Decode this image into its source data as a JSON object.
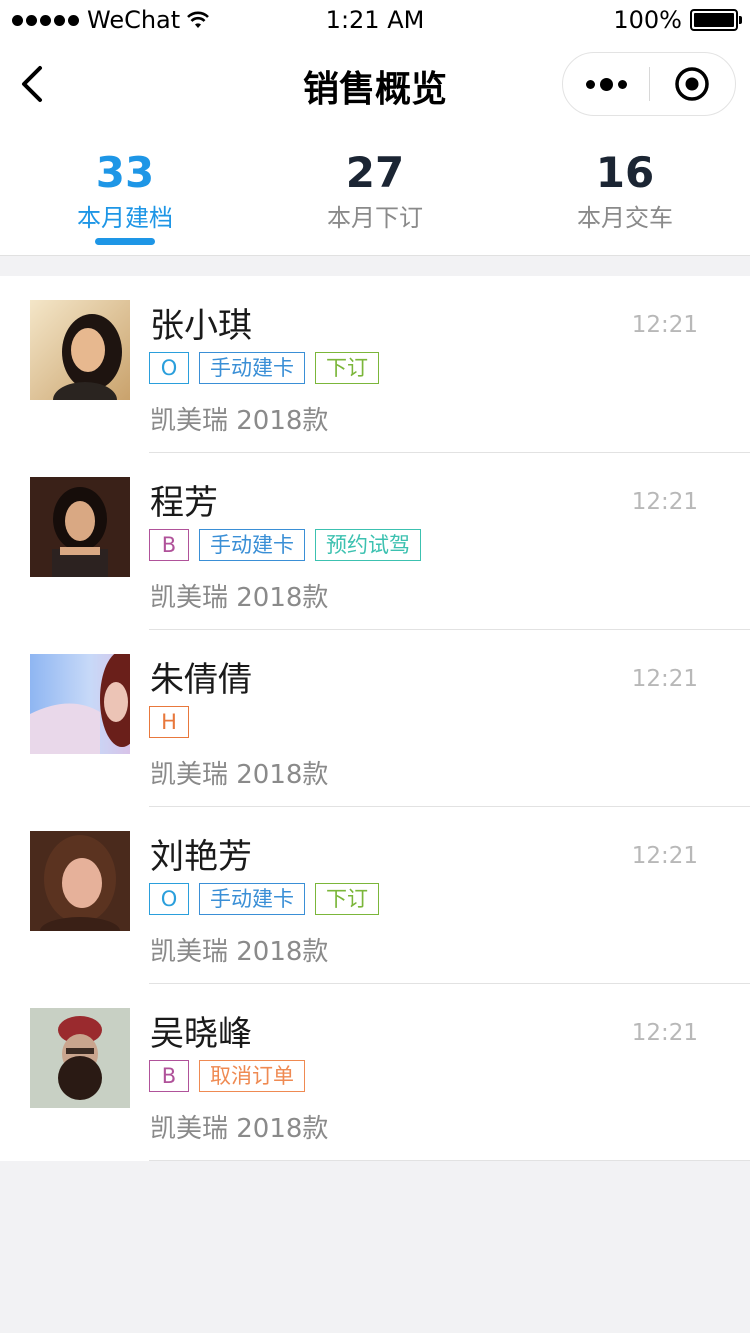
{
  "status_bar": {
    "carrier": "WeChat",
    "time": "1:21 AM",
    "battery": "100%"
  },
  "nav": {
    "title": "销售概览"
  },
  "stats": [
    {
      "num": "33",
      "label": "本月建档",
      "active": true
    },
    {
      "num": "27",
      "label": "本月下订",
      "active": false
    },
    {
      "num": "16",
      "label": "本月交车",
      "active": false
    }
  ],
  "customers": [
    {
      "name": "张小琪",
      "time": "12:21",
      "car": "凯美瑞 2018款",
      "tags": [
        {
          "text": "O",
          "color": "#2a9fdc"
        },
        {
          "text": "手动建卡",
          "color": "#3a8fd6"
        },
        {
          "text": "下订",
          "color": "#7bb63a"
        }
      ]
    },
    {
      "name": "程芳",
      "time": "12:21",
      "car": "凯美瑞 2018款",
      "tags": [
        {
          "text": "B",
          "color": "#b0529a"
        },
        {
          "text": "手动建卡",
          "color": "#3a8fd6"
        },
        {
          "text": "预约试驾",
          "color": "#3cc1b0"
        }
      ]
    },
    {
      "name": "朱倩倩",
      "time": "12:21",
      "car": "凯美瑞 2018款",
      "tags": [
        {
          "text": "H",
          "color": "#e8783c"
        }
      ]
    },
    {
      "name": "刘艳芳",
      "time": "12:21",
      "car": "凯美瑞 2018款",
      "tags": [
        {
          "text": "O",
          "color": "#2a9fdc"
        },
        {
          "text": "手动建卡",
          "color": "#3a8fd6"
        },
        {
          "text": "下订",
          "color": "#7bb63a"
        }
      ]
    },
    {
      "name": "吴晓峰",
      "time": "12:21",
      "car": "凯美瑞 2018款",
      "tags": [
        {
          "text": "B",
          "color": "#b0529a"
        },
        {
          "text": "取消订单",
          "color": "#ef8a52"
        }
      ]
    }
  ],
  "colors": {
    "accent": "#1e96e6"
  }
}
